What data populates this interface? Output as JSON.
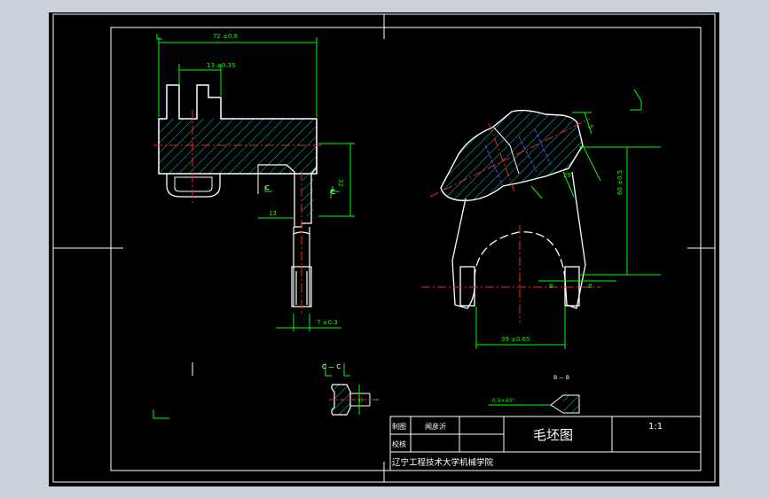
{
  "drawing": {
    "dims": {
      "d_72": "72 ±0.8",
      "d_13a": "13 ±0.35",
      "d_32": "32",
      "d_13b": "13",
      "d_7": "7 ±0.3",
      "d_29": "29",
      "d_60": "60 ±0.5",
      "d_8a": "8",
      "d_8b": "8",
      "d_39": "39 ±0.65",
      "d_5": "5",
      "d_chamfer": "0.5×43°",
      "d_small": "0"
    },
    "sections": {
      "c_left": "C",
      "c_right": "C",
      "cc_title": "C — C",
      "bb_title": "B — B"
    }
  },
  "title_block": {
    "label_drawn": "制图",
    "drawn_by": "闻彦沂",
    "label_checked": "校核",
    "drawing_title": "毛坯图",
    "scale": "1:1",
    "institution": "辽宁工程技术大学机械学院"
  },
  "colors": {
    "background": "#000000",
    "outline": "#ffffff",
    "dimension": "#00ff00",
    "centerline": "#ff2020",
    "hatch": "#00ffff",
    "hidden": "#5050ff"
  }
}
